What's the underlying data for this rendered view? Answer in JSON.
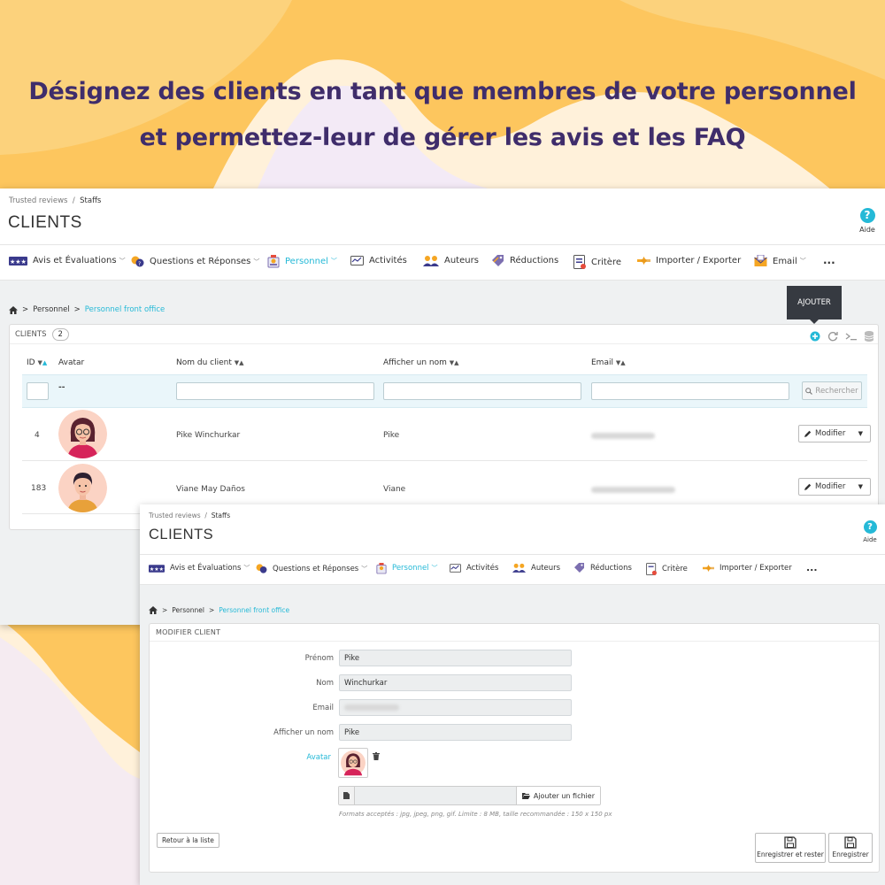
{
  "headline": {
    "line1": "Désignez des clients en tant que membres de votre personnel",
    "line2": "et permettez-leur de gérer les avis et les FAQ"
  },
  "colors": {
    "accent": "#25b9d7",
    "headline": "#3f2d6b",
    "background": "#fdc65e"
  },
  "app": {
    "breadcrumb": {
      "root": "Trusted reviews",
      "sep": "/",
      "current": "Staffs"
    },
    "title": "CLIENTS",
    "help_label": "Aide",
    "help_icon": "?",
    "nav": [
      {
        "label": "Avis et Évaluations",
        "icon": "stars-icon",
        "dropdown": true,
        "active": false
      },
      {
        "label": "Questions et Réponses",
        "icon": "qa-icon",
        "dropdown": true,
        "active": false
      },
      {
        "label": "Personnel",
        "icon": "staff-icon",
        "dropdown": true,
        "active": true
      },
      {
        "label": "Activités",
        "icon": "activity-icon",
        "dropdown": false,
        "active": false
      },
      {
        "label": "Auteurs",
        "icon": "authors-icon",
        "dropdown": false,
        "active": false
      },
      {
        "label": "Réductions",
        "icon": "discount-icon",
        "dropdown": false,
        "active": false
      },
      {
        "label": "Critère",
        "icon": "criteria-icon",
        "dropdown": false,
        "active": false
      },
      {
        "label": "Importer / Exporter",
        "icon": "import-export-icon",
        "dropdown": false,
        "active": false
      },
      {
        "label": "Email",
        "icon": "email-icon",
        "dropdown": true,
        "active": false
      }
    ],
    "nav_more": "...",
    "sub_breadcrumb": {
      "sep": ">",
      "parent": "Personnel",
      "current": "Personnel front office"
    }
  },
  "list": {
    "title": "CLIENTS",
    "count": "2",
    "tooltip": "AJOUTER",
    "columns": [
      "ID",
      "Avatar",
      "Nom du client",
      "Afficher un nom",
      "Email"
    ],
    "filter_avatar": "--",
    "search_label": "Rechercher",
    "rows": [
      {
        "id": "4",
        "name": "Pike Winchurkar",
        "display": "Pike",
        "action": "Modifier"
      },
      {
        "id": "183",
        "name": "Viane May Daños",
        "display": "Viane",
        "action": "Modifier"
      }
    ]
  },
  "form": {
    "title": "MODIFIER CLIENT",
    "fields": [
      {
        "label": "Prénom",
        "value": "Pike"
      },
      {
        "label": "Nom",
        "value": "Winchurkar"
      },
      {
        "label": "Email",
        "value": ""
      },
      {
        "label": "Afficher un nom",
        "value": "Pike"
      }
    ],
    "avatar_label": "Avatar",
    "upload_button": "Ajouter un fichier",
    "formats_hint": "Formats acceptés : jpg, jpeg, png, gif. Limite : 8 MB, taille recommandée : 150 x 150 px",
    "back_button": "Retour à la liste",
    "save_stay_button": "Enregistrer et rester",
    "save_button": "Enregistrer"
  }
}
